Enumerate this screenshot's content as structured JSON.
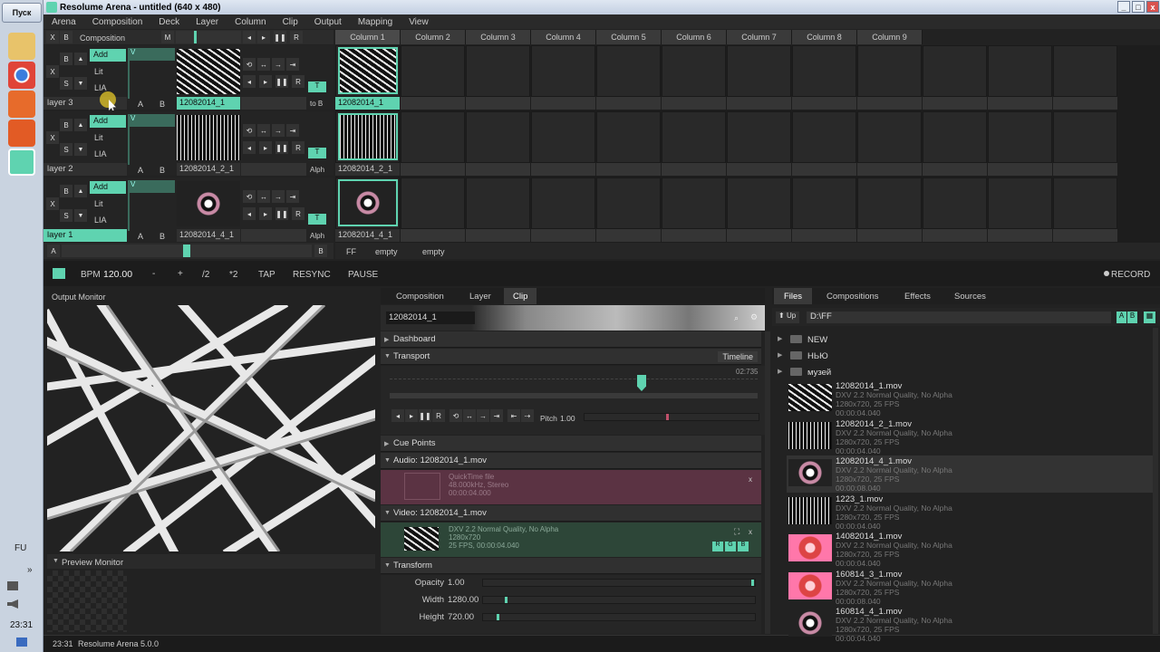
{
  "taskbar": {
    "start": "Пуск",
    "lang": "FU",
    "clock": "23:31",
    "collapse": "»"
  },
  "window": {
    "title": "Resolume Arena - untitled (640 x 480)",
    "min": "_",
    "max": "□",
    "close": "x"
  },
  "menu": [
    "Arena",
    "Composition",
    "Deck",
    "Layer",
    "Column",
    "Clip",
    "Output",
    "Mapping",
    "View"
  ],
  "comp_header": {
    "x": "X",
    "b": "B",
    "label": "Composition",
    "m": "M"
  },
  "columns": [
    "Column 1",
    "Column 2",
    "Column 3",
    "Column 4",
    "Column 5",
    "Column 6",
    "Column 7",
    "Column 8",
    "Column 9"
  ],
  "layers": [
    {
      "name": "layer 3",
      "blend": "Add",
      "lit": "Lit",
      "lia": "LIA",
      "a": "A",
      "b": "B",
      "clip": "12082014_1",
      "extra": "to B",
      "t": "T",
      "v": "V",
      "x": "X",
      "s": "S",
      "bb": "B"
    },
    {
      "name": "layer 2",
      "blend": "Add",
      "lit": "Lit",
      "lia": "LIA",
      "a": "A",
      "b": "B",
      "clip": "12082014_2_1",
      "extra": "Alph",
      "t": "T",
      "v": "V",
      "x": "X",
      "s": "S",
      "bb": "B"
    },
    {
      "name": "layer 1",
      "blend": "Add",
      "lit": "Lit",
      "lia": "LIA",
      "a": "A",
      "b": "B",
      "clip": "12082014_4_1",
      "extra": "Alph",
      "t": "T",
      "v": "V",
      "x": "X",
      "s": "S",
      "bb": "B"
    }
  ],
  "grid_clips": [
    "12082014_1",
    "12082014_2_1",
    "12082014_4_1"
  ],
  "deck": {
    "a": "A",
    "b": "B",
    "ff": "FF",
    "empty1": "empty",
    "empty2": "empty"
  },
  "bpm_bar": {
    "bpm_label": "BPM",
    "bpm": "120.00",
    "minus": "-",
    "plus": "+",
    "half": "/2",
    "double": "*2",
    "tap": "TAP",
    "resync": "RESYNC",
    "pause": "PAUSE",
    "record": "RECORD"
  },
  "output_monitor": "Output Monitor",
  "preview_monitor": "Preview Monitor",
  "tabs_mid": [
    "Composition",
    "Layer",
    "Clip"
  ],
  "clip_panel": {
    "name": "12082014_1",
    "dashboard": "Dashboard",
    "transport": "Transport",
    "timeline": "Timeline",
    "duration": "02:735",
    "pitch_label": "Pitch",
    "pitch": "1.00",
    "cue": "Cue Points",
    "audio": "Audio: 12082014_1.mov",
    "audio_info": [
      "QuickTime file",
      "48.000kHz, Stereo",
      "00:00:04.000"
    ],
    "video": "Video: 12082014_1.mov",
    "video_info": [
      "DXV 2.2 Normal Quality, No Alpha",
      "1280x720",
      "25 FPS, 00:00:04.040"
    ],
    "rgb": [
      "R",
      "G",
      "B"
    ],
    "transform": "Transform",
    "params": [
      {
        "label": "Opacity",
        "value": "1.00",
        "fill": 1.0
      },
      {
        "label": "Width",
        "value": "1280.00",
        "fill": 0.08
      },
      {
        "label": "Height",
        "value": "720.00",
        "fill": 0.05
      }
    ]
  },
  "tabs_right": [
    "Files",
    "Compositions",
    "Effects",
    "Sources"
  ],
  "files": {
    "up": "Up",
    "path": "D:\\FF",
    "a": "A",
    "b": "B",
    "folders": [
      "NEW",
      "НЬЮ",
      "музей"
    ],
    "items": [
      {
        "name": "12082014_1.mov",
        "d1": "DXV 2.2 Normal Quality, No Alpha",
        "d2": "1280x720, 25 FPS",
        "d3": "00:00:04.040"
      },
      {
        "name": "12082014_2_1.mov",
        "d1": "DXV 2.2 Normal Quality, No Alpha",
        "d2": "1280x720, 25 FPS",
        "d3": "00:00:04.040"
      },
      {
        "name": "12082014_4_1.mov",
        "d1": "DXV 2.2 Normal Quality, No Alpha",
        "d2": "1280x720, 25 FPS",
        "d3": "00:00:08.040"
      },
      {
        "name": "1223_1.mov",
        "d1": "DXV 2.2 Normal Quality, No Alpha",
        "d2": "1280x720, 25 FPS",
        "d3": "00:00:04.040"
      },
      {
        "name": "14082014_1.mov",
        "d1": "DXV 2.2 Normal Quality, No Alpha",
        "d2": "1280x720, 25 FPS",
        "d3": "00:00:04.040"
      },
      {
        "name": "160814_3_1.mov",
        "d1": "DXV 2.2 Normal Quality, No Alpha",
        "d2": "1280x720, 25 FPS",
        "d3": "00:00:08.040"
      },
      {
        "name": "160814_4_1.mov",
        "d1": "DXV 2.2 Normal Quality, No Alpha",
        "d2": "1280x720, 25 FPS",
        "d3": "00:00:04.040"
      }
    ]
  },
  "status": {
    "time": "23:31",
    "version": "Resolume Arena 5.0.0"
  },
  "colors": {
    "accent": "#5fd3b0",
    "audio": "#6a3a4a",
    "video": "#2f4a3a",
    "playhead": "#c0506a"
  }
}
